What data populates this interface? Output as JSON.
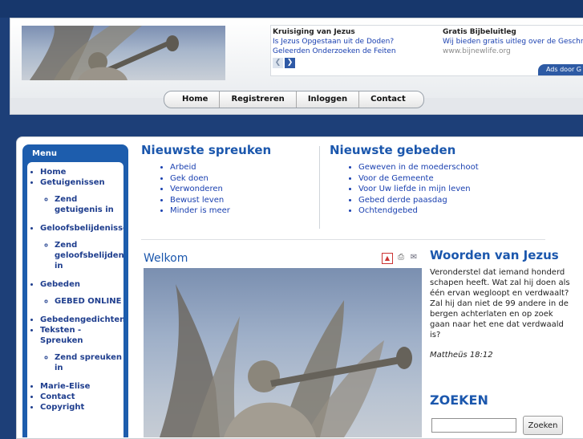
{
  "ads": {
    "ad1": {
      "title": "Kruisiging van Jezus",
      "text": "Is Jezus Opgestaan uit de Doden? Geleerden Onderzoeken de Feiten"
    },
    "ad2": {
      "title": "Gratis Bijbeluitleg",
      "text": "Wij bieden gratis uitleg over de Geschriften",
      "url": "www.bijnewlife.org"
    },
    "ads_by": "Ads door G"
  },
  "nav": [
    "Home",
    "Registreren",
    "Inloggen",
    "Contact"
  ],
  "menu": {
    "title": "Menu",
    "items": {
      "home": "Home",
      "getuigenissen": "Getuigenissen",
      "zend_getuigenis": "Zend getuigenis in",
      "geloofsbelijdenissen": "Geloofsbelijdenissen",
      "zend_geloofsbelijdenis": "Zend geloofsbelijdenis in",
      "gebeden": "Gebeden",
      "gebed_online": "GEBED ONLINE",
      "gebedengedichten": "Gebedengedichten",
      "teksten_spreuken": "Teksten - Spreuken",
      "zend_spreuken": "Zend spreuken in",
      "marie_elise": "Marie-Elise",
      "contact": "Contact",
      "copyright": "Copyright"
    }
  },
  "spreuken": {
    "title": "Nieuwste spreuken",
    "items": [
      "Arbeid",
      "Gek doen",
      "Verwonderen",
      "Bewust leven",
      "Minder is meer"
    ]
  },
  "gebeden": {
    "title": "Nieuwste gebeden",
    "items": [
      "Geweven in de moederschoot",
      "Voor de Gemeente",
      "Voor Uw liefde in mijn leven",
      "Gebed derde paasdag",
      "Ochtendgebed"
    ]
  },
  "article": {
    "title": "Welkom"
  },
  "woorden": {
    "title": "Woorden van Jezus",
    "text": "Veronderstel dat iemand honderd schapen heeft. Wat zal hij doen als één ervan wegloopt en verdwaalt? Zal hij dan niet de 99 andere in de bergen achterlaten en op zoek gaan naar het ene dat verdwaald is?",
    "reference": "Mattheüs 18:12"
  },
  "zoeken": {
    "title": "ZOEKEN",
    "button": "Zoeken",
    "value": ""
  },
  "colors": {
    "page_bg": "#1d3f78",
    "menu_blue": "#1d5dad",
    "heading_blue": "#1b57ad",
    "link_blue": "#1a40b0"
  }
}
